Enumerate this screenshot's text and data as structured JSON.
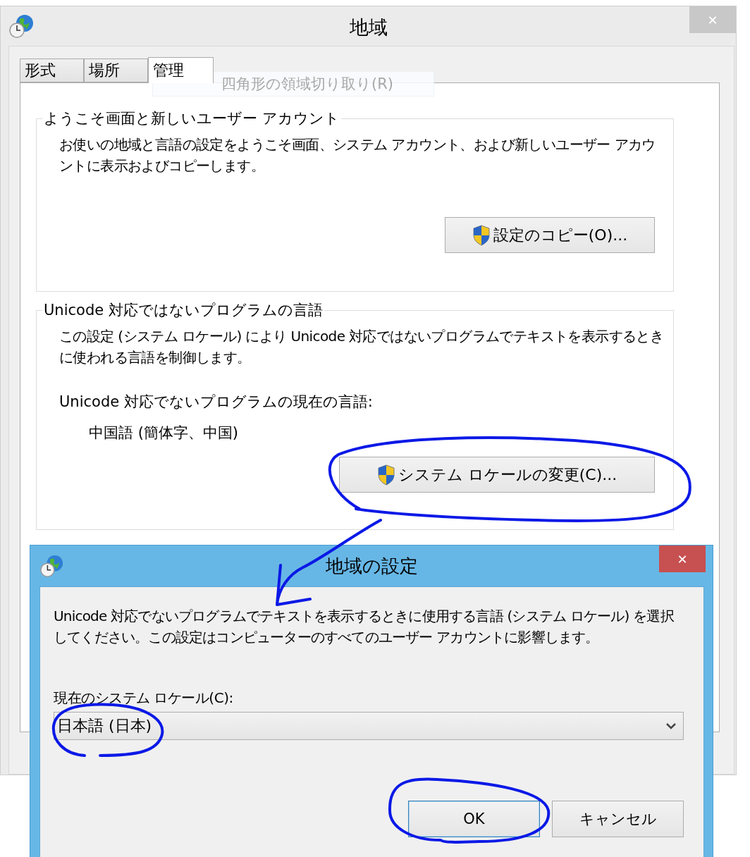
{
  "window": {
    "title": "地域",
    "close": "✕"
  },
  "tabs": [
    {
      "label": "形式",
      "selected": false
    },
    {
      "label": "場所",
      "selected": false
    },
    {
      "label": "管理",
      "selected": true
    }
  ],
  "tooltip": "四角形の領域切り取り(R)",
  "groups": [
    {
      "title": "ようこそ画面と新しいユーザー アカウント",
      "items": [
        {
          "kind": "paragraph",
          "text": "お使いの地域と言語の設定をようこそ画面、システム アカウント、および新しいユーザー アカウントに表示およびコピーします。"
        }
      ],
      "button": {
        "label": "設定のコピー(O)...",
        "shield": true
      }
    },
    {
      "title": "Unicode 対応ではないプログラムの言語",
      "items": [
        {
          "kind": "paragraph",
          "text": "この設定 (システム ロケール) により Unicode 対応ではないプログラムでテキストを表示するときに使われる言語を制御します。"
        },
        {
          "kind": "label",
          "text": "Unicode 対応でないプログラムの現在の言語:"
        },
        {
          "kind": "value",
          "text": "中国語 (簡体字、中国)"
        }
      ],
      "button": {
        "label": "システム ロケールの変更(C)...",
        "shield": true
      }
    }
  ],
  "dialog": {
    "title": "地域の設定",
    "close": "✕",
    "description": "Unicode 対応でないプログラムでテキストを表示するときに使用する言語 (システム ロケール) を選択してください。この設定はコンピューターのすべてのユーザー アカウントに影響します。",
    "field_label": "現在のシステム ロケール(C):",
    "select_value": "日本語 (日本)",
    "buttons": [
      {
        "label": "OK",
        "default": true
      },
      {
        "label": "キャンセル",
        "default": false
      }
    ]
  }
}
